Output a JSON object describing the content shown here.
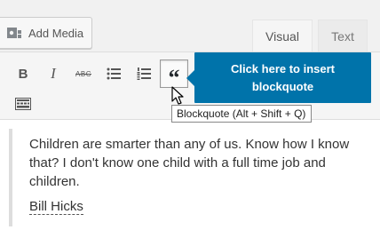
{
  "toolbar_top": {
    "add_media_label": "Add Media",
    "tabs": [
      {
        "label": "Visual",
        "active": true
      },
      {
        "label": "Text",
        "active": false
      }
    ]
  },
  "toolbar": {
    "bold": "B",
    "italic": "I",
    "strikethrough": "ABC",
    "blockquote": "“"
  },
  "pointer": {
    "line1": "Click here to insert",
    "line2": "blockquote"
  },
  "tooltip": "Blockquote (Alt + Shift + Q)",
  "content": {
    "quote": "Children are smarter than any of us. Know how I know that? I don't know one child with a full time job and children.",
    "cite": "Bill Hicks"
  },
  "colors": {
    "accent": "#0073aa",
    "background": "#f1f1f1"
  }
}
